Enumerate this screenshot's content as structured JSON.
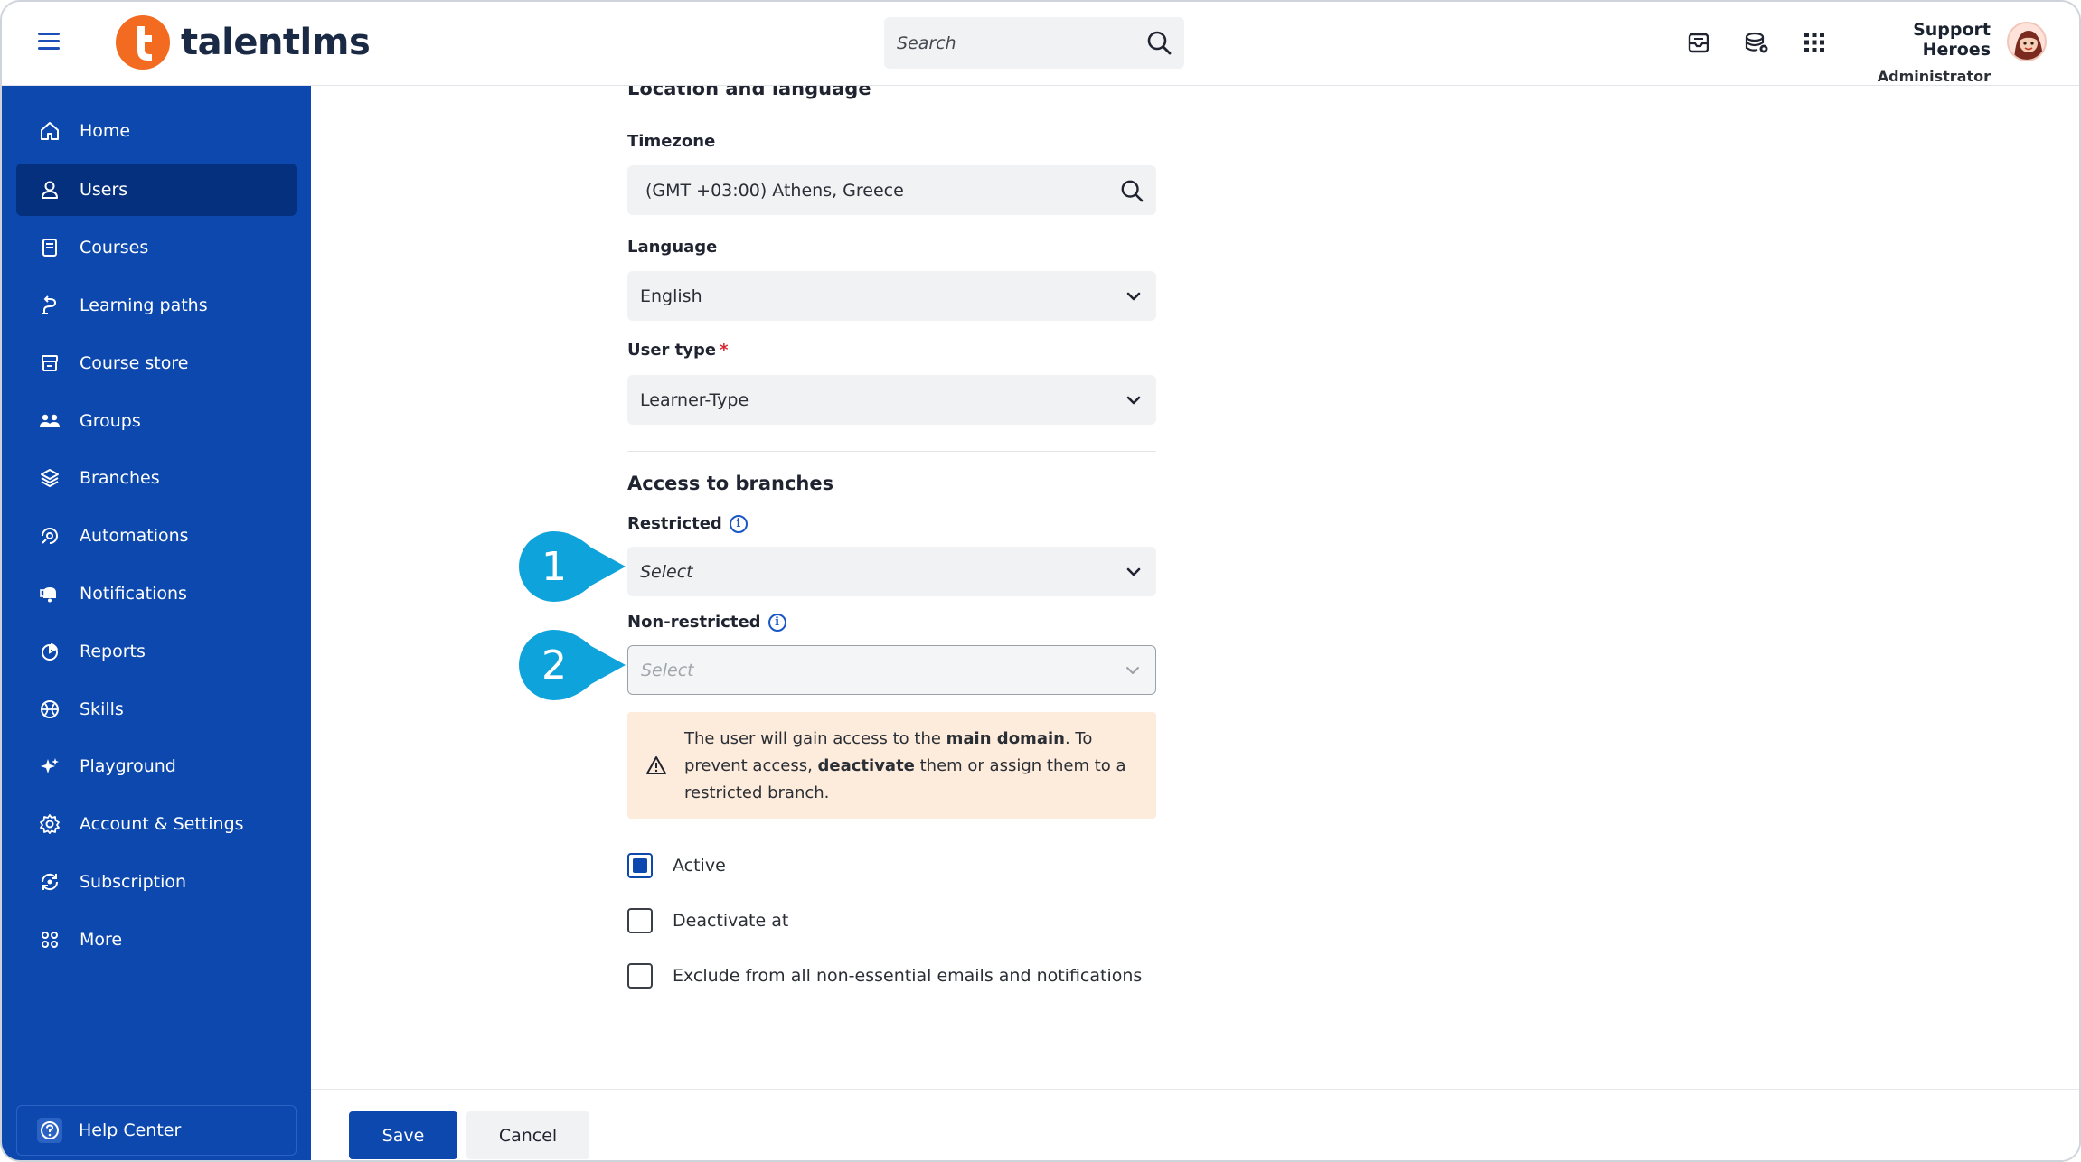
{
  "app": {
    "logo_text": "talentlms"
  },
  "colors": {
    "brand_blue": "#0c48ad",
    "sidebar_active": "#05307e",
    "logo_orange": "#f26b21",
    "callout_cyan": "#0fa3dc",
    "warning_bg": "#fdebdc"
  },
  "topbar": {
    "search_placeholder": "Search",
    "icons": [
      "menu-icon",
      "messages-icon",
      "coins-settings-icon",
      "apps-grid-icon"
    ],
    "user_name": "Support Heroes",
    "user_role": "Administrator"
  },
  "sidebar": {
    "items": [
      {
        "label": "Home",
        "icon": "home-icon"
      },
      {
        "label": "Users",
        "icon": "user-icon",
        "active": true
      },
      {
        "label": "Courses",
        "icon": "courses-icon"
      },
      {
        "label": "Learning paths",
        "icon": "learning-paths-icon"
      },
      {
        "label": "Course store",
        "icon": "store-icon"
      },
      {
        "label": "Groups",
        "icon": "groups-icon"
      },
      {
        "label": "Branches",
        "icon": "branches-icon"
      },
      {
        "label": "Automations",
        "icon": "automations-icon"
      },
      {
        "label": "Notifications",
        "icon": "notifications-icon"
      },
      {
        "label": "Reports",
        "icon": "reports-icon"
      },
      {
        "label": "Skills",
        "icon": "skills-icon"
      },
      {
        "label": "Playground",
        "icon": "playground-icon"
      },
      {
        "label": "Account & Settings",
        "icon": "settings-icon"
      },
      {
        "label": "Subscription",
        "icon": "subscription-icon"
      },
      {
        "label": "More",
        "icon": "more-icon"
      }
    ],
    "help_label": "Help Center"
  },
  "form": {
    "location_section": "Location and language",
    "timezone_label": "Timezone",
    "timezone_value": "(GMT +03:00) Athens, Greece",
    "language_label": "Language",
    "language_value": "English",
    "user_type_label": "User type",
    "user_type_required": "*",
    "user_type_value": "Learner-Type",
    "access_section": "Access to branches",
    "restricted_label": "Restricted",
    "restricted_value": "Select",
    "non_restricted_label": "Non-restricted",
    "non_restricted_value": "Select",
    "warning": {
      "part1": "The user will gain access to the ",
      "bold1": "main domain",
      "part2": ". To prevent access, ",
      "bold2": "deactivate",
      "part3": " them or assign them to a restricted branch."
    },
    "checkboxes": [
      {
        "label": "Active",
        "checked": true
      },
      {
        "label": "Deactivate at",
        "checked": false
      },
      {
        "label": "Exclude from all non-essential emails and notifications",
        "checked": false
      }
    ]
  },
  "footer": {
    "save_label": "Save",
    "cancel_label": "Cancel"
  },
  "callouts": [
    "1",
    "2"
  ]
}
